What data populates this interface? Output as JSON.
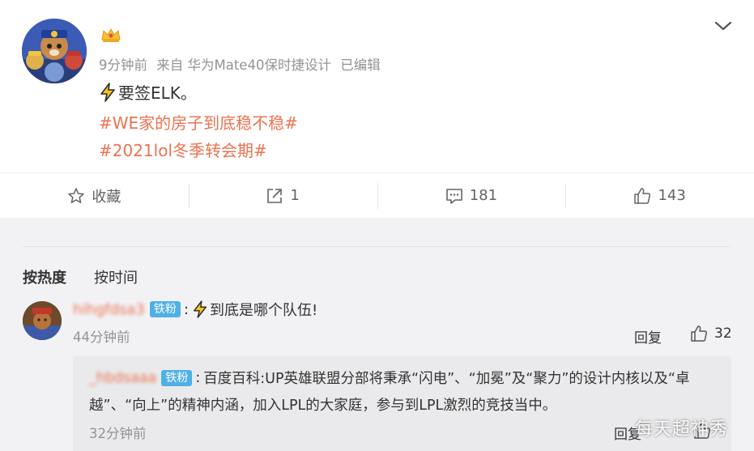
{
  "post": {
    "meta": {
      "time": "9分钟前",
      "source": "来自 华为Mate40保时捷设计",
      "edited": "已编辑"
    },
    "text": "要签ELK。",
    "topics": [
      "#WE家的房子到底稳不稳#",
      "#2021lol冬季转会期#"
    ],
    "icons": {
      "badge": "crown-badge-icon",
      "expand": "chevron-down-icon",
      "emoji": "lightning-emoji-icon"
    }
  },
  "actions": {
    "favorite_label": "收藏",
    "repost_count": "1",
    "comment_count": "181",
    "like_count": "143"
  },
  "comments": {
    "sort_hot": "按热度",
    "sort_time": "按时间",
    "items": [
      {
        "username": "hihgfdsa3",
        "badge": "铁粉",
        "text": "到底是哪个队伍!",
        "time": "44分钟前",
        "reply_label": "回复",
        "likes": "32",
        "reply": {
          "username": "_hbdsaaa",
          "badge": "铁粉",
          "text_line1": "百度百科:UP英雄联盟分部将秉承“闪电”、“加冕”及“聚力”的设计内核以及“卓",
          "text_line2": "越”、“向上”的精神内涵，加入LPL的大家庭，参与到LPL激烈的竞技当中。",
          "time": "32分钟前",
          "reply_label": "回复"
        }
      }
    ]
  },
  "watermark": "每天超神秀",
  "colors": {
    "accent": "#eb7350",
    "meta_gray": "#939393",
    "fan_badge": "#4fb0e6",
    "comment_bg": "#f2f2f5"
  }
}
